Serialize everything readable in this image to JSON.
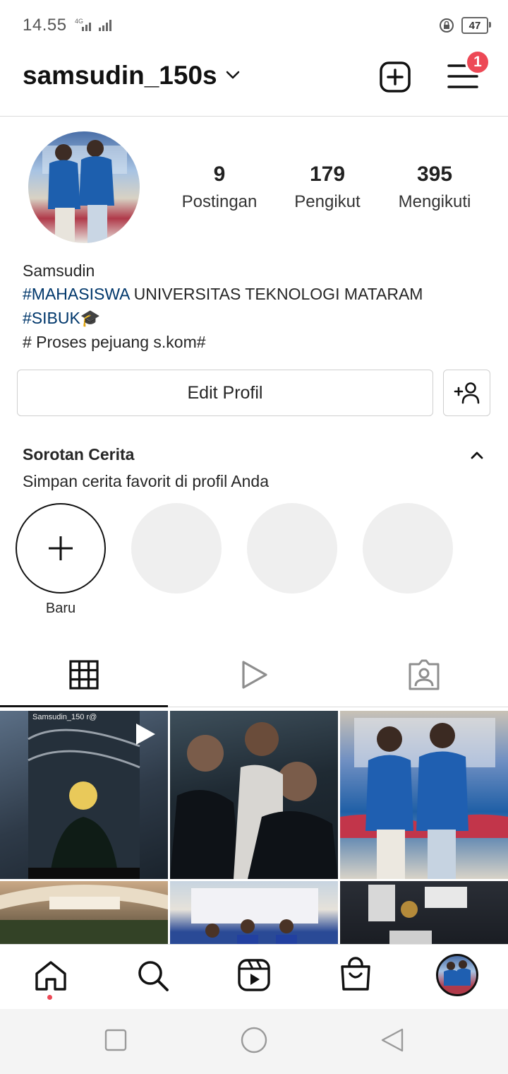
{
  "status_bar": {
    "time": "14.55",
    "network": "4G",
    "battery": "47"
  },
  "header": {
    "username": "samsudin_150s",
    "notification_count": "1"
  },
  "profile": {
    "stats": [
      {
        "value": "9",
        "label": "Postingan"
      },
      {
        "value": "179",
        "label": "Pengikut"
      },
      {
        "value": "395",
        "label": "Mengikuti"
      }
    ],
    "name": "Samsudin",
    "bio_line1_tag": "#MAHASISWA",
    "bio_line1_text": " UNIVERSITAS TEKNOLOGI MATARAM",
    "bio_line2_tag": "#SIBUK",
    "bio_line2_emoji": "🎓",
    "bio_line3": "# Proses pejuang s.kom#",
    "edit_button": "Edit Profil"
  },
  "highlights": {
    "title": "Sorotan Cerita",
    "subtitle": "Simpan cerita favorit di profil Anda",
    "new_label": "Baru"
  },
  "posts": {
    "reel_username": "Samsudin_150 r@"
  },
  "colors": {
    "accent": "#ed4956",
    "hashtag": "#00376b"
  },
  "icons": {
    "nav": [
      "home-icon",
      "search-icon",
      "reels-icon",
      "shop-icon",
      "profile-avatar"
    ],
    "tabs": [
      "grid-icon",
      "reels-tab-icon",
      "tagged-icon"
    ]
  }
}
